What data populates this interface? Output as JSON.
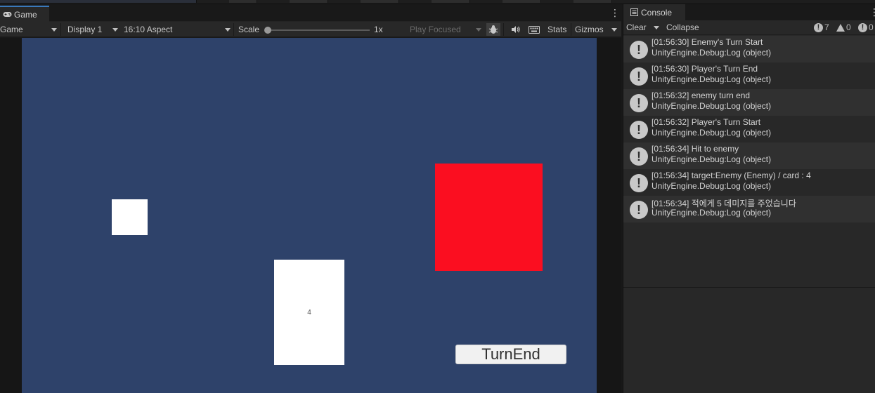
{
  "game": {
    "tab_label": "Game",
    "toolbar": {
      "mode": "Game",
      "display": "Display 1",
      "aspect": "16:10 Aspect",
      "scale_label": "Scale",
      "scale_value": "1x",
      "scale_level": 0,
      "play_mode": "Play Focused",
      "stats": "Stats",
      "gizmos": "Gizmos"
    },
    "scene": {
      "card_value": "4",
      "turn_end_label": "TurnEnd",
      "colors": {
        "background": "#2e426a",
        "enemy": "#fb0e20",
        "player": "#ffffff"
      }
    }
  },
  "console": {
    "tab_label": "Console",
    "toolbar": {
      "clear": "Clear",
      "collapse": "Collapse",
      "log_count": "7",
      "warning_count": "0",
      "error_count": "0"
    },
    "entries": [
      {
        "line1": "[01:56:30] Enemy's Turn Start",
        "line2": "UnityEngine.Debug:Log (object)"
      },
      {
        "line1": "[01:56:30] Player's Turn End",
        "line2": "UnityEngine.Debug:Log (object)"
      },
      {
        "line1": "[01:56:32] enemy turn end",
        "line2": "UnityEngine.Debug:Log (object)"
      },
      {
        "line1": "[01:56:32] Player's Turn Start",
        "line2": "UnityEngine.Debug:Log (object)"
      },
      {
        "line1": "[01:56:34] Hit to enemy",
        "line2": "UnityEngine.Debug:Log (object)"
      },
      {
        "line1": "[01:56:34] target:Enemy (Enemy) / card : 4",
        "line2": "UnityEngine.Debug:Log (object)"
      },
      {
        "line1": "[01:56:34] 적에게 5 데미지를 주었습니다",
        "line2": "UnityEngine.Debug:Log (object)"
      }
    ]
  }
}
